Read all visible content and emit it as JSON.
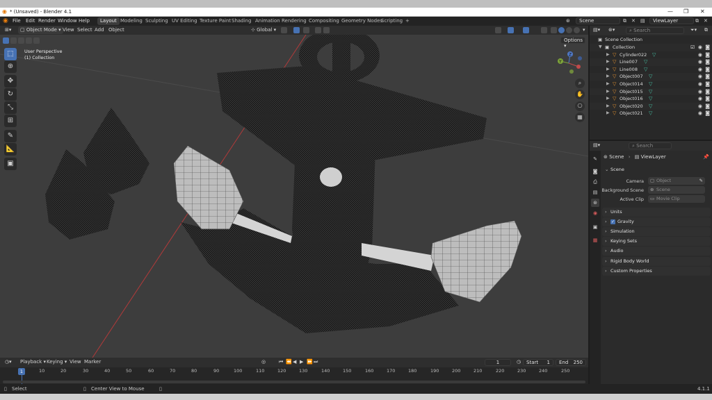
{
  "window": {
    "title": "* (Unsaved) - Blender 4.1",
    "controls": [
      "—",
      "❐",
      "✕"
    ]
  },
  "menu": [
    "File",
    "Edit",
    "Render",
    "Window",
    "Help"
  ],
  "workspaces": [
    "Layout",
    "Modeling",
    "Sculpting",
    "UV Editing",
    "Texture Paint",
    "Shading",
    "Animation",
    "Rendering",
    "Compositing",
    "Geometry Nodes",
    "Scripting"
  ],
  "active_workspace": "Layout",
  "add_workspace": "+",
  "scene_field": "Scene",
  "viewlayer_field": "ViewLayer",
  "viewport_header": {
    "mode": "Object Mode",
    "menus": [
      "View",
      "Select",
      "Add",
      "Object"
    ],
    "transform": "Global",
    "options": "Options"
  },
  "viewport": {
    "perspective": "User Perspective",
    "collection": "(1) Collection",
    "gizmo": {
      "x": "X",
      "y": "Y",
      "z": "Z"
    }
  },
  "tools": [
    "select-box",
    "cursor",
    "move",
    "rotate",
    "scale",
    "transform",
    "annotate",
    "measure",
    "add-cube"
  ],
  "outliner": {
    "search_placeholder": "Search",
    "root": "Scene Collection",
    "collection": "Collection",
    "objects": [
      "Cylinder022",
      "Line007",
      "Line008",
      "Object007",
      "Object014",
      "Object015",
      "Object016",
      "Object020",
      "Object021"
    ]
  },
  "properties": {
    "search_placeholder": "Search",
    "breadcrumb": [
      "Scene",
      "ViewLayer"
    ],
    "scene_panel": "Scene",
    "camera_label": "Camera",
    "camera_value": "Object",
    "bg_label": "Background Scene",
    "bg_value": "Scene",
    "clip_label": "Active Clip",
    "clip_value": "Movie Clip",
    "panels": [
      "Units",
      "Gravity",
      "Simulation",
      "Keying Sets",
      "Audio",
      "Rigid Body World",
      "Custom Properties"
    ],
    "gravity_checked": true
  },
  "timeline": {
    "menus": [
      "Playback",
      "Keying",
      "View",
      "Marker"
    ],
    "current_frame": "1",
    "start_label": "Start",
    "start": "1",
    "end_label": "End",
    "end": "250",
    "ticks": [
      "10",
      "20",
      "30",
      "40",
      "50",
      "60",
      "70",
      "80",
      "90",
      "100",
      "110",
      "120",
      "130",
      "140",
      "150",
      "160",
      "170",
      "180",
      "190",
      "200",
      "210",
      "220",
      "230",
      "240",
      "250"
    ],
    "playhead": "1"
  },
  "status": {
    "left": "Select",
    "middle": "Center View to Mouse",
    "version": "4.1.1"
  }
}
